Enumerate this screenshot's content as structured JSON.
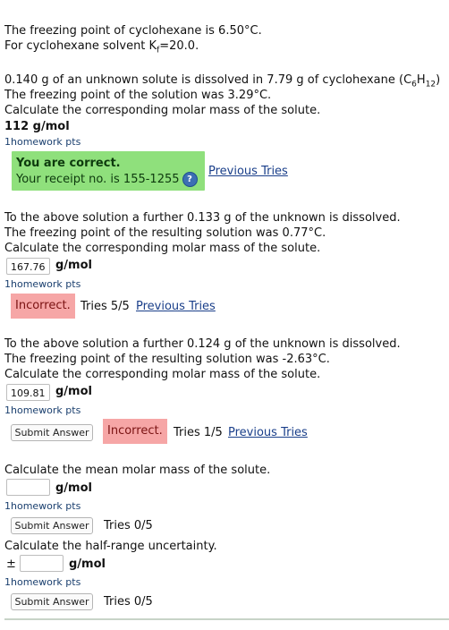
{
  "intro": {
    "line1": "The freezing point of cyclohexane is 6.50°C.",
    "line2_prefix": "For cyclohexane solvent K",
    "line2_sub": "f",
    "line2_suffix": "=20.0."
  },
  "q1": {
    "line1_prefix": "0.140 g of an unknown solute is dissolved in 7.79 g of cyclohexane (C",
    "line1_sub1": "6",
    "line1_mid": "H",
    "line1_sub2": "12",
    "line1_suffix": ")",
    "line2": "The freezing point of the solution was 3.29°C.",
    "line3": "Calculate the corresponding molar mass of the solute.",
    "answer": "112 g/mol",
    "pts": "1homework pts",
    "feedback_title": "You are correct.",
    "feedback_receipt": "Your receipt no. is 155-1255",
    "help_icon": "?",
    "previous_tries": "Previous Tries"
  },
  "q2": {
    "line1": "To the above solution a further 0.133 g of the unknown is dissolved.",
    "line2": "The freezing point of the resulting solution was 0.77°C.",
    "line3": "Calculate the corresponding molar mass of the solute.",
    "input_value": "167.76",
    "unit": "g/mol",
    "pts": "1homework pts",
    "status": "Incorrect.",
    "tries": "Tries 5/5",
    "previous_tries": "Previous Tries"
  },
  "q3": {
    "line1": "To the above solution a further 0.124 g of the unknown is dissolved.",
    "line2": "The freezing point of the resulting solution was -2.63°C.",
    "line3": "Calculate the corresponding molar mass of the solute.",
    "input_value": "109.81",
    "unit": "g/mol",
    "pts": "1homework pts",
    "submit": "Submit Answer",
    "status": "Incorrect.",
    "tries": "Tries 1/5",
    "previous_tries": "Previous Tries"
  },
  "q4": {
    "line1": "Calculate the mean molar mass of the solute.",
    "input_value": "",
    "unit": "g/mol",
    "pts": "1homework pts",
    "submit": "Submit Answer",
    "tries": "Tries 0/5"
  },
  "q5": {
    "line1": "Calculate the half-range uncertainty.",
    "pm": "±",
    "input_value": "",
    "unit": "g/mol",
    "pts": "1homework pts",
    "submit": "Submit Answer",
    "tries": "Tries 0/5"
  }
}
